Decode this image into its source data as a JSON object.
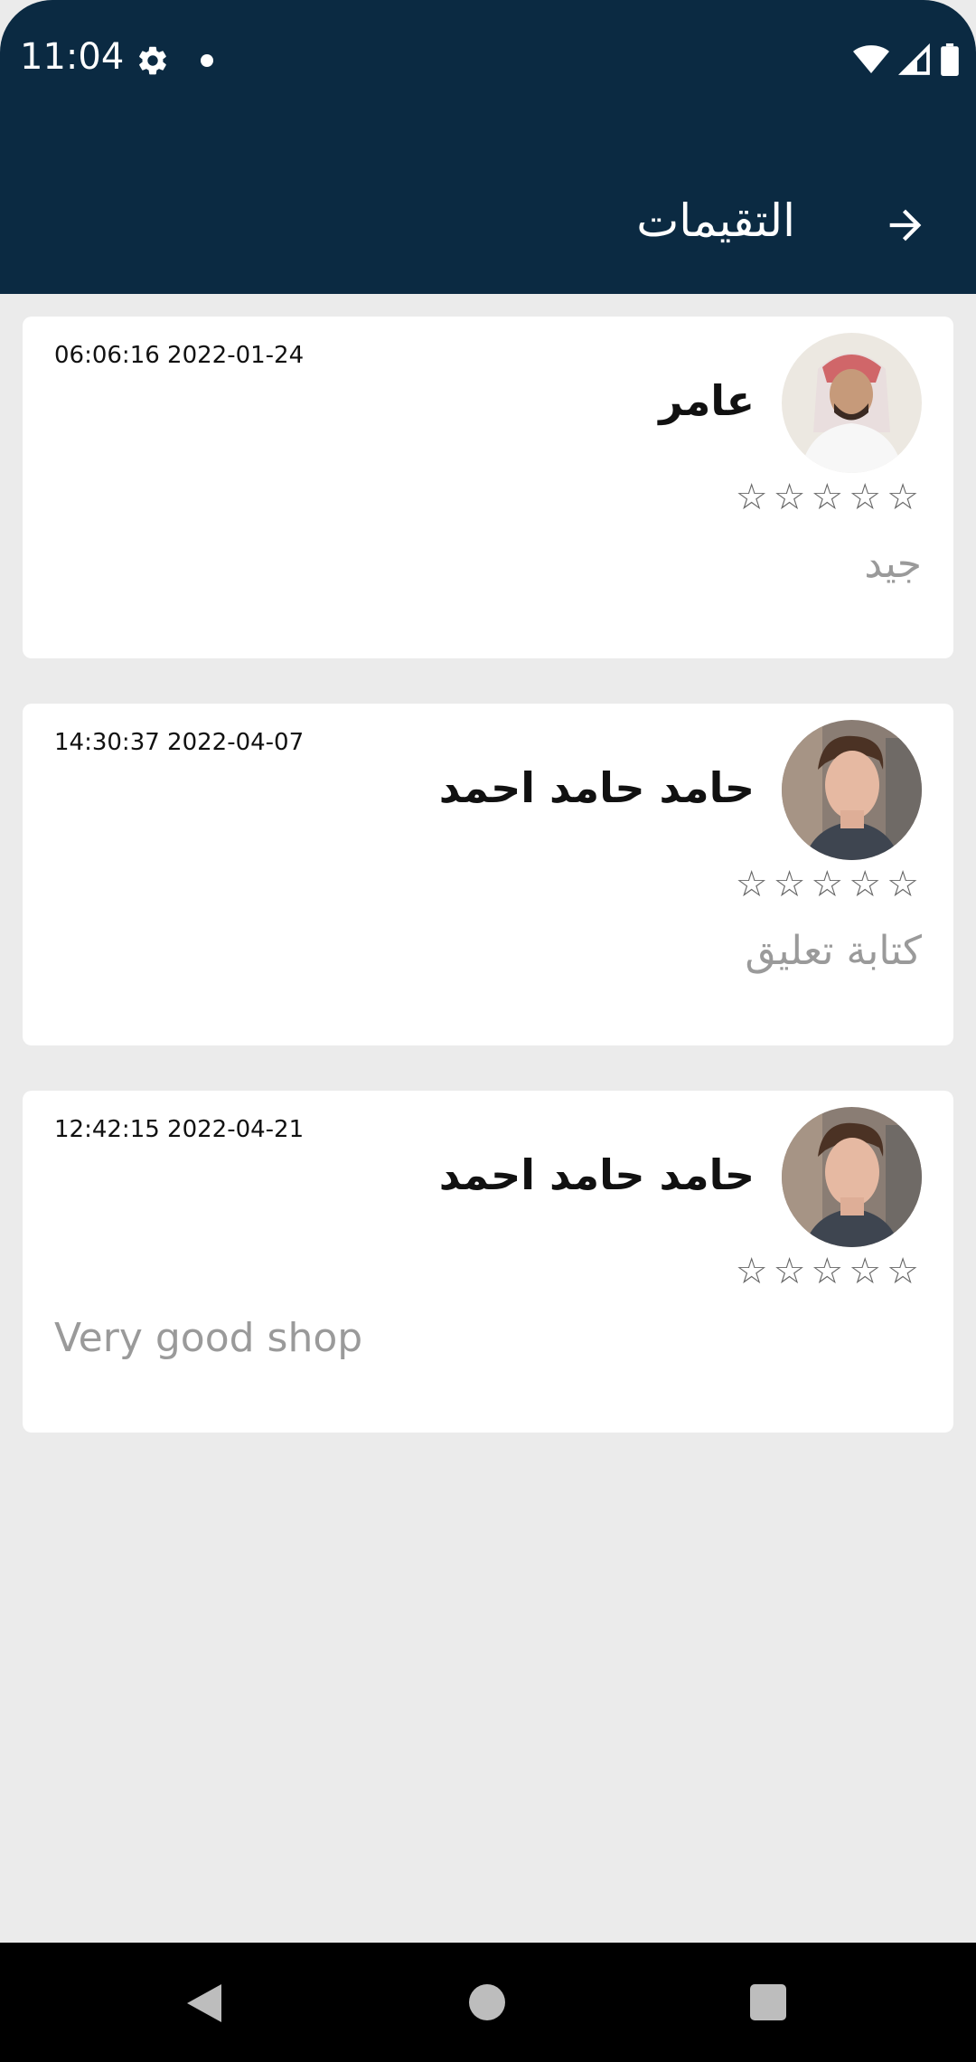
{
  "status_bar": {
    "time": "11:04"
  },
  "app_bar": {
    "title": "التقيمات"
  },
  "reviews": [
    {
      "name": "عامر",
      "date": "06:06:16 2022-01-24",
      "rating": 0,
      "comment": "جيد",
      "comment_dir": "rtl"
    },
    {
      "name": "حامد حامد احمد",
      "date": "14:30:37 2022-04-07",
      "rating": 0,
      "comment": "كتابة تعليق",
      "comment_dir": "rtl"
    },
    {
      "name": "حامد حامد احمد",
      "date": "12:42:15 2022-04-21",
      "rating": 0,
      "comment": "Very good shop",
      "comment_dir": "ltr"
    }
  ],
  "colors": {
    "header": "#0b2a42",
    "background": "#ebebeb",
    "card": "#ffffff",
    "comment": "#9a9a9a"
  },
  "icons": {
    "back": "arrow-right-icon",
    "star": "star-outline-icon"
  }
}
